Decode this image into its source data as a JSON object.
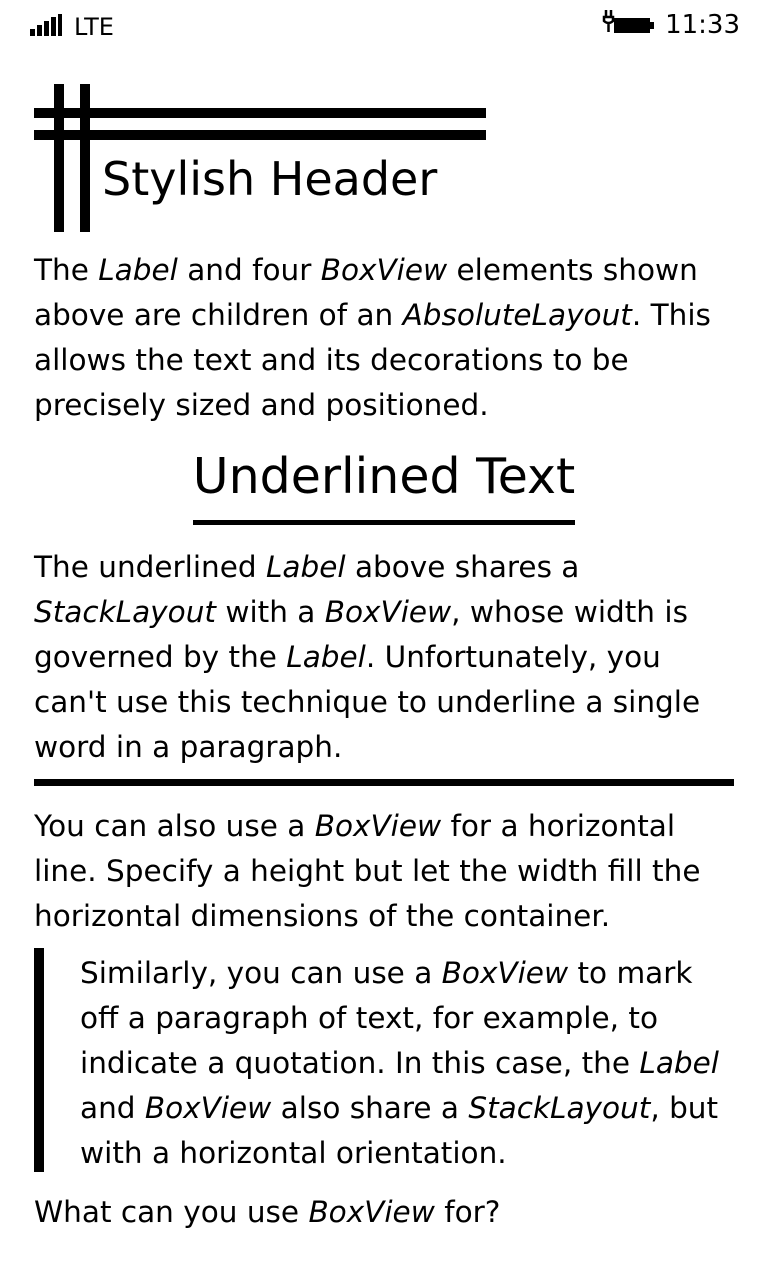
{
  "status_bar": {
    "network": "LTE",
    "time": "11:33",
    "signal_icon": "signal-bars-icon",
    "battery_icon": "battery-charging-icon"
  },
  "header": {
    "title": "Stylish Header"
  },
  "paragraph1": {
    "s1": "The ",
    "e1": "Label",
    "s2": " and four ",
    "e2": "BoxView",
    "s3": " elements shown above are children of an ",
    "e3": "AbsoluteLayout",
    "s4": ". This allows the text and its decorations to be precisely sized and positioned."
  },
  "underlined": {
    "title": "Underlined Text"
  },
  "paragraph2": {
    "s1": "The underlined ",
    "e1": "Label",
    "s2": " above shares a ",
    "e2": "StackLayout",
    "s3": " with a ",
    "e3": "BoxView",
    "s4": ", whose width is governed by the ",
    "e4": "Label",
    "s5": ". Unfortunately, you can't use this technique to underline a single word in a paragraph."
  },
  "paragraph3": {
    "s1": "You can also use a ",
    "e1": "BoxView",
    "s2": " for a horizontal line. Specify a height but let the width fill the horizontal dimensions of the container."
  },
  "quote": {
    "s1": "Similarly, you can use a ",
    "e1": "BoxView",
    "s2": " to mark off a paragraph of text, for example, to indicate a quotation. In this case, the ",
    "e2": "Label",
    "s3": " and ",
    "e3": "BoxView",
    "s4": " also share a ",
    "e4": "StackLayout",
    "s5": ", but with a horizontal orientation."
  },
  "paragraph5": {
    "s1": "What can you use ",
    "e1": "BoxView",
    "s2": " for?"
  }
}
